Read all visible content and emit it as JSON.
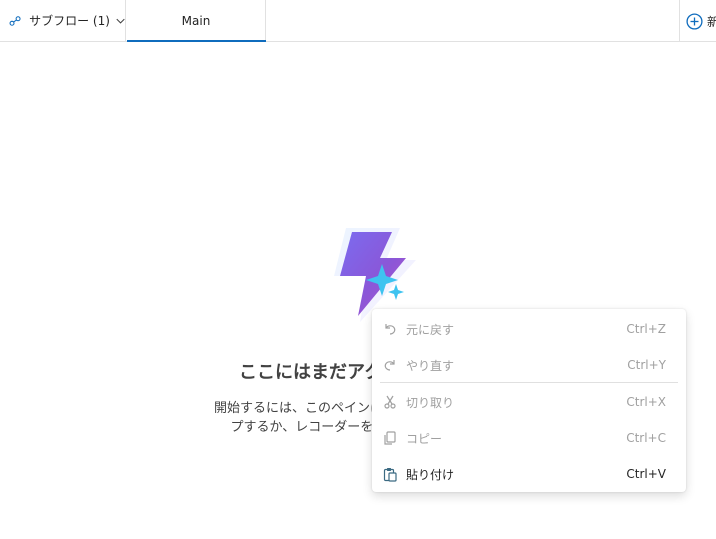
{
  "header": {
    "subflow_label": "サブフロー (1)",
    "main_tab_label": "Main",
    "new_button_label": "新",
    "accent_color": "#0f6cbd"
  },
  "empty_state": {
    "title": "ここにはまだアクシ",
    "description_line1": "開始するには、このペインにア",
    "description_line2": "プするか、レコーダーを使用"
  },
  "context_menu": {
    "items": [
      {
        "label": "元に戻す",
        "shortcut": "Ctrl+Z",
        "icon": "undo-icon",
        "enabled": false
      },
      {
        "label": "やり直す",
        "shortcut": "Ctrl+Y",
        "icon": "redo-icon",
        "enabled": false
      },
      {
        "label": "切り取り",
        "shortcut": "Ctrl+X",
        "icon": "cut-icon",
        "enabled": false
      },
      {
        "label": "コピー",
        "shortcut": "Ctrl+C",
        "icon": "copy-icon",
        "enabled": false
      },
      {
        "label": "貼り付け",
        "shortcut": "Ctrl+V",
        "icon": "paste-icon",
        "enabled": true
      }
    ]
  }
}
